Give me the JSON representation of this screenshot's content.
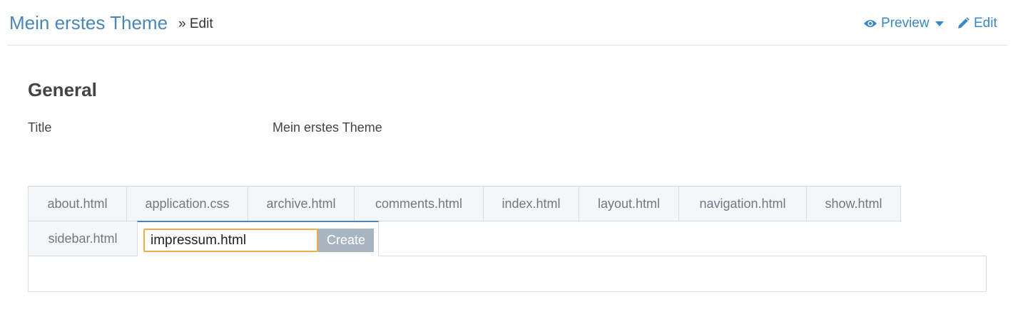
{
  "header": {
    "theme_title": "Mein erstes Theme",
    "breadcrumb_separator": "»",
    "breadcrumb_current": "Edit",
    "preview_label": "Preview",
    "edit_label": "Edit",
    "link_color": "#3a87c8"
  },
  "general": {
    "heading": "General",
    "title_label": "Title",
    "title_value": "Mein erstes Theme"
  },
  "file_tabs": {
    "row1": [
      "about.html",
      "application.css",
      "archive.html",
      "comments.html",
      "index.html",
      "layout.html",
      "navigation.html",
      "show.html"
    ],
    "row2": [
      "sidebar.html"
    ],
    "new_file_input_value": "impressum.html",
    "create_button_label": "Create",
    "input_focus_color": "#f0ad4e"
  }
}
